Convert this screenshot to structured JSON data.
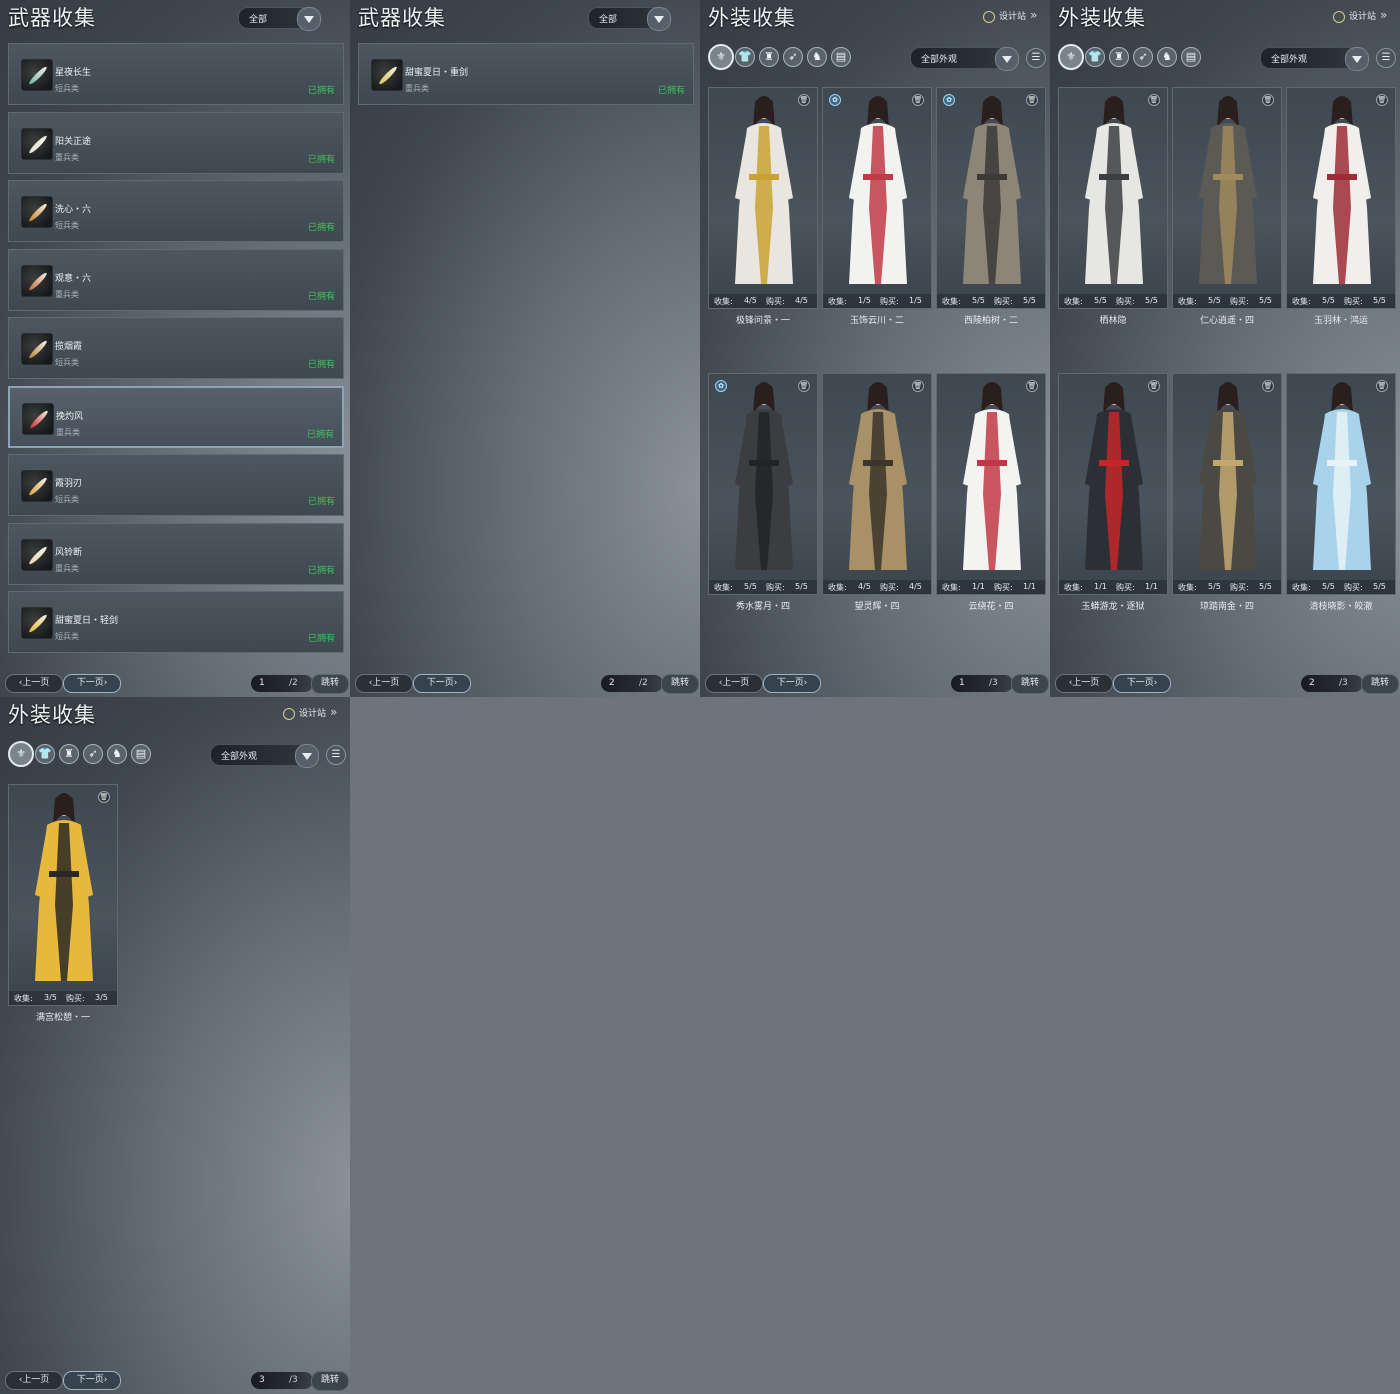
{
  "common": {
    "prev_label": "上一页",
    "next_label": "下一页",
    "jump_label": "跳转",
    "owned_label": "已拥有",
    "collect_label": "收集:",
    "buy_label": "购买:",
    "design_label": "设计站"
  },
  "weapon_panels": [
    {
      "title": "武器收集",
      "filter": "全部",
      "page": "1",
      "total": "/2",
      "items": [
        {
          "name": "星夜长生",
          "type": "短兵类",
          "color": "#6fb8a6"
        },
        {
          "name": "阳关正途",
          "type": "重兵类",
          "color": "#e8e3d6"
        },
        {
          "name": "洗心・六",
          "type": "短兵类",
          "color": "#c9822e"
        },
        {
          "name": "观意・六",
          "type": "重兵类",
          "color": "#c86a3a"
        },
        {
          "name": "揽烟霞",
          "type": "短兵类",
          "color": "#b9863a"
        },
        {
          "name": "挽灼风",
          "type": "重兵类",
          "color": "#d8262a"
        },
        {
          "name": "霞羽刃",
          "type": "短兵类",
          "color": "#d8a24a"
        },
        {
          "name": "风铃断",
          "type": "重兵类",
          "color": "#e8dcb4"
        },
        {
          "name": "甜蜜夏日・轻剑",
          "type": "短兵类",
          "color": "#e6b93c"
        }
      ]
    },
    {
      "title": "武器收集",
      "filter": "全部",
      "page": "2",
      "total": "/2",
      "items": [
        {
          "name": "甜蜜夏日・重剑",
          "type": "重兵类",
          "color": "#d9c94a"
        }
      ]
    }
  ],
  "outfit_panels": [
    {
      "title": "外装收集",
      "filter": "全部外观",
      "page": "1",
      "total": "/3",
      "items": [
        {
          "name": "极锋问景・一",
          "collect": "4/5",
          "buy": "4/5",
          "tag": false,
          "main": "#e9e6df",
          "accent": "#c9a232"
        },
        {
          "name": "玉饰云川・二",
          "collect": "1/5",
          "buy": "1/5",
          "tag": true,
          "main": "#f2f2f0",
          "accent": "#c13b46"
        },
        {
          "name": "西陵柏树・二",
          "collect": "5/5",
          "buy": "5/5",
          "tag": true,
          "main": "#8d8678",
          "accent": "#3a3a38"
        },
        {
          "name": "秀水雾月・四",
          "collect": "5/5",
          "buy": "5/5",
          "tag": true,
          "main": "#3b3d40",
          "accent": "#222426"
        },
        {
          "name": "望灵辉・四",
          "collect": "4/5",
          "buy": "4/5",
          "tag": false,
          "main": "#a89067",
          "accent": "#3c352b"
        },
        {
          "name": "云绕花・四",
          "collect": "1/1",
          "buy": "1/1",
          "tag": false,
          "main": "#f3f3f1",
          "accent": "#bf3845"
        }
      ]
    },
    {
      "title": "外装收集",
      "filter": "全部外观",
      "page": "2",
      "total": "/3",
      "items": [
        {
          "name": "栖林隐",
          "collect": "5/5",
          "buy": "5/5",
          "tag": false,
          "main": "#e6e6e3",
          "accent": "#3b3d40"
        },
        {
          "name": "仁心逍遥・四",
          "collect": "5/5",
          "buy": "5/5",
          "tag": false,
          "main": "#5b5a55",
          "accent": "#a08a5e"
        },
        {
          "name": "玉羽林・鸿运",
          "collect": "5/5",
          "buy": "5/5",
          "tag": false,
          "main": "#f0efec",
          "accent": "#9e2b36"
        },
        {
          "name": "玉蟒游龙・逐狱",
          "collect": "1/1",
          "buy": "1/1",
          "tag": false,
          "main": "#2c2f33",
          "accent": "#c6262a"
        },
        {
          "name": "琼踏南金・四",
          "collect": "5/5",
          "buy": "5/5",
          "tag": false,
          "main": "#4a4944",
          "accent": "#c2a870"
        },
        {
          "name": "清枝晓影・皎澈",
          "collect": "5/5",
          "buy": "5/5",
          "tag": false,
          "main": "#a9d3ea",
          "accent": "#e8f2f7"
        }
      ]
    },
    {
      "title": "外装收集",
      "filter": "全部外观",
      "page": "3",
      "total": "/3",
      "items": [
        {
          "name": "满宫松憩・一",
          "collect": "3/5",
          "buy": "3/5",
          "tag": false,
          "main": "#e8b83c",
          "accent": "#2a2824"
        }
      ]
    }
  ],
  "category_icons": [
    "all-outfit-icon",
    "top-icon",
    "bottom-icon",
    "weapon-skin-icon",
    "mount-icon",
    "accessory-icon"
  ]
}
